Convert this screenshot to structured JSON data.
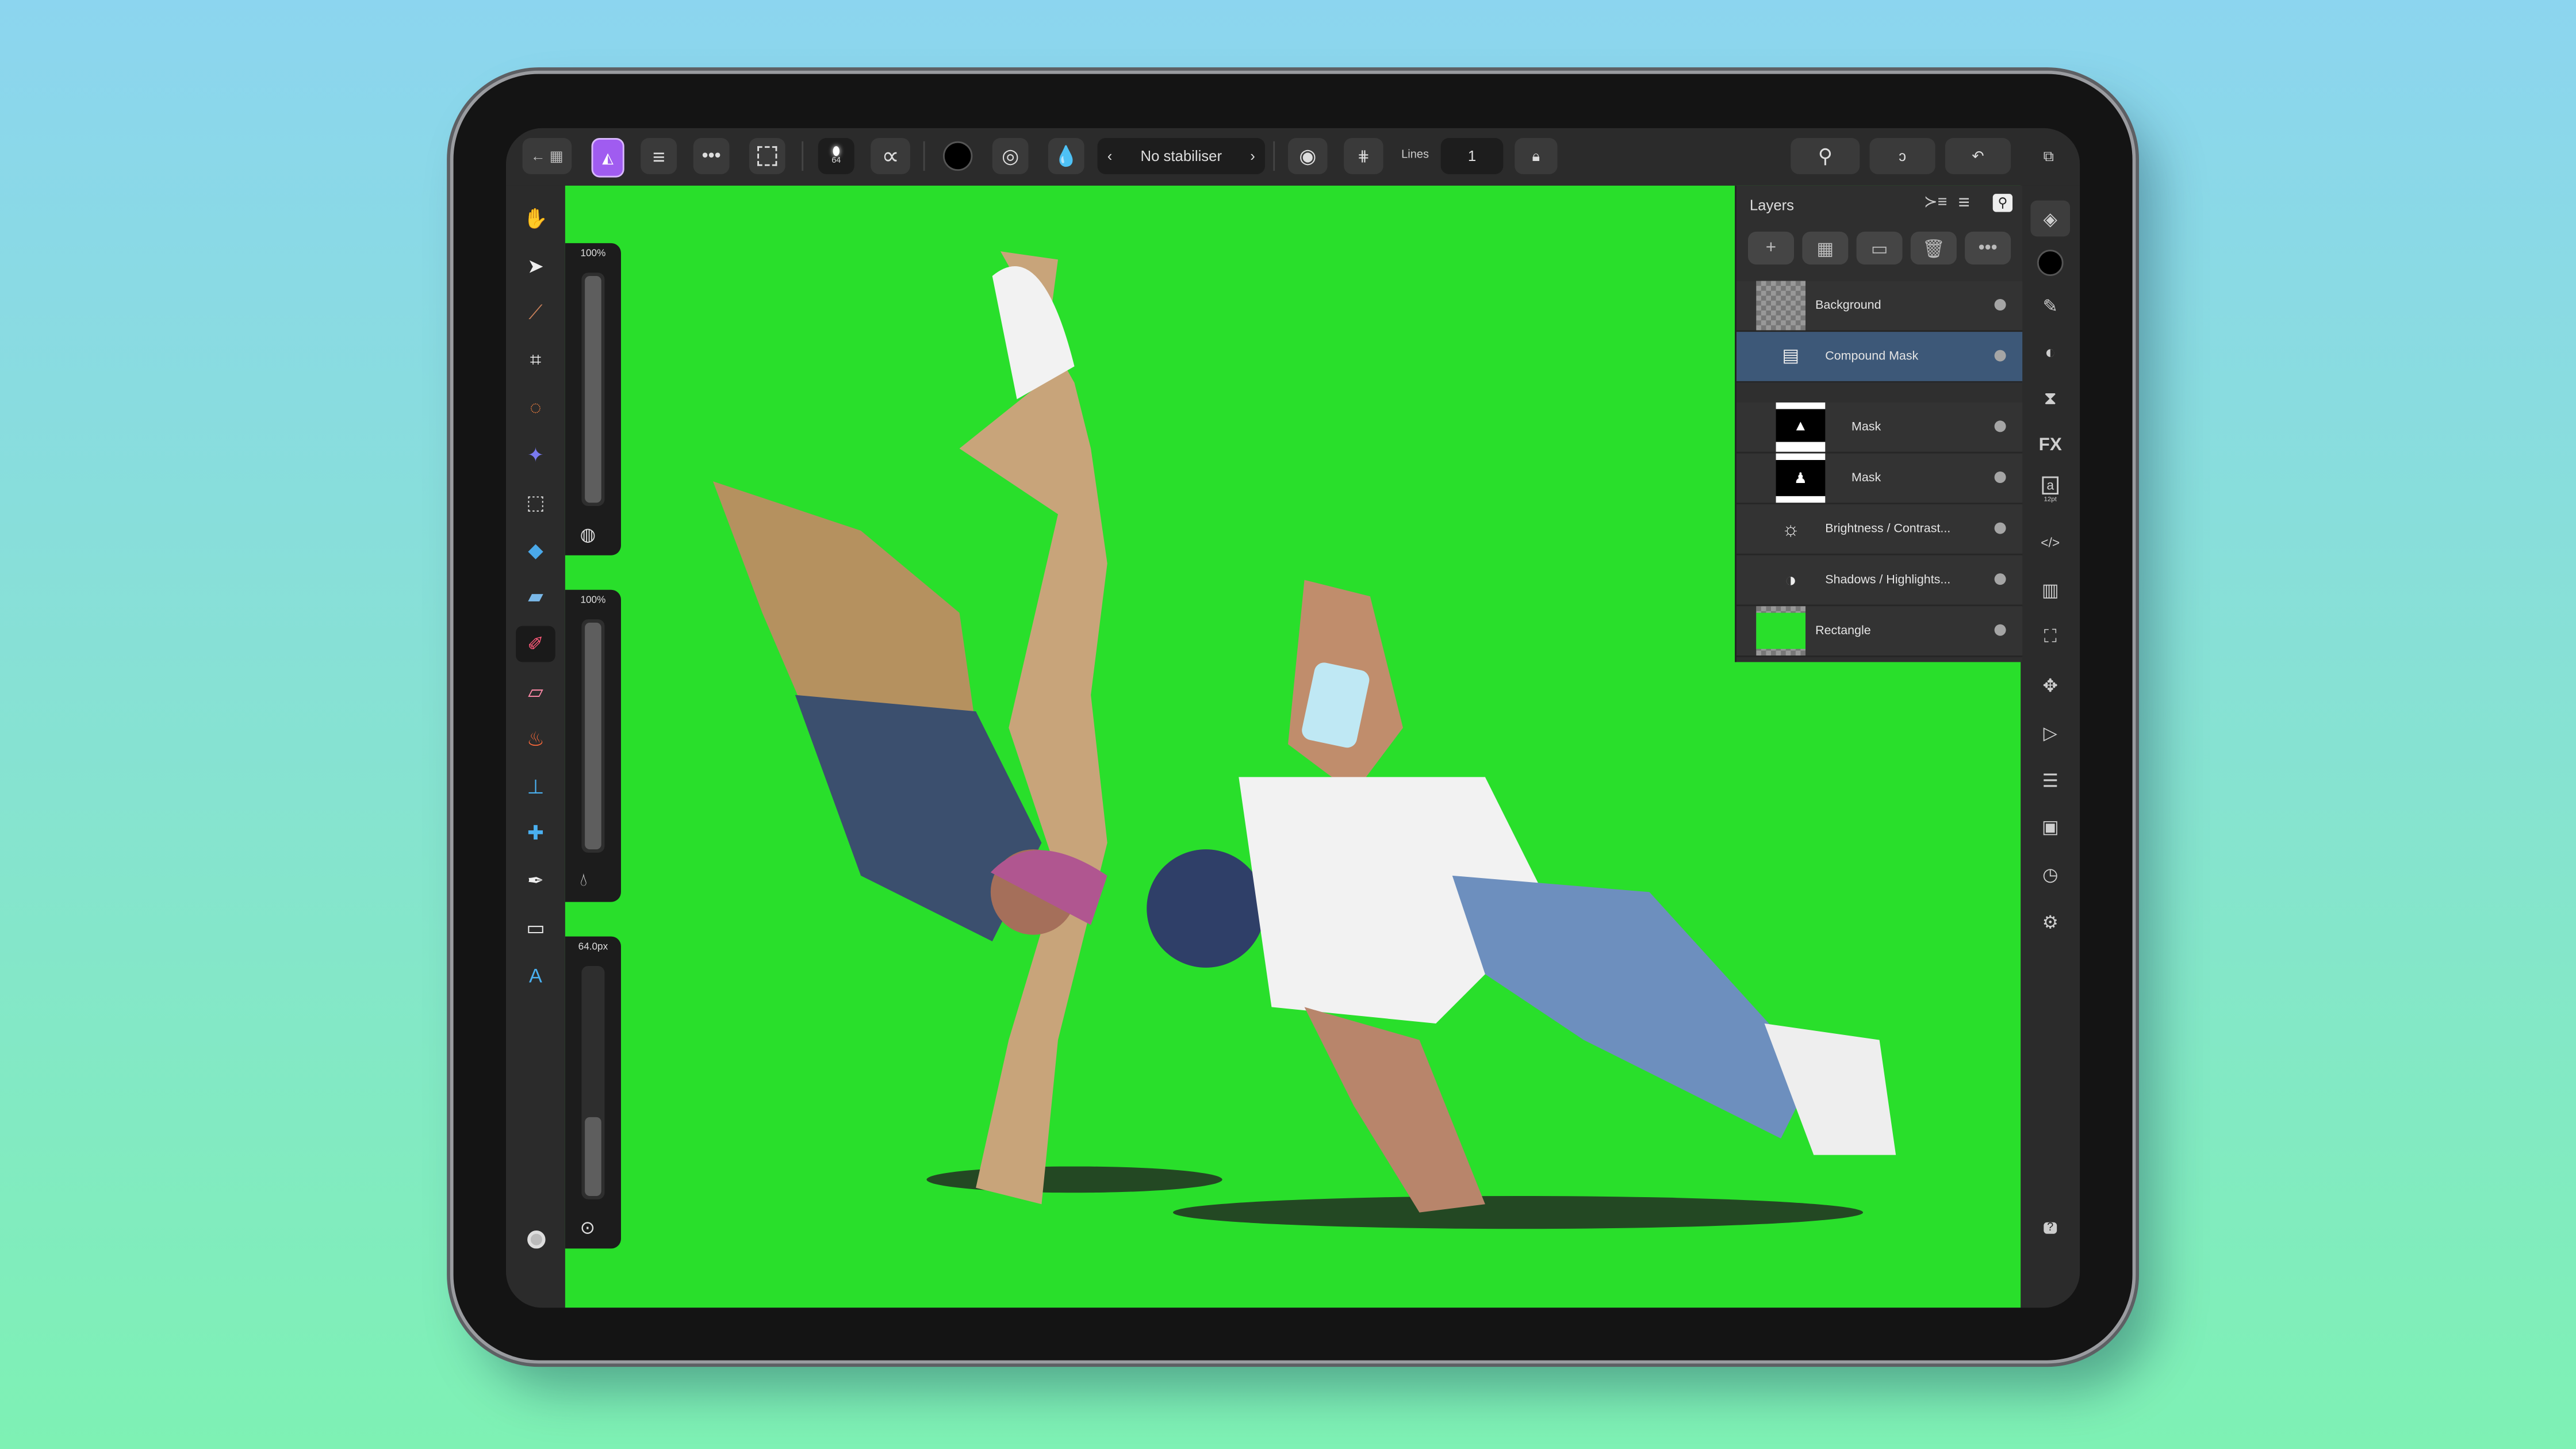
{
  "toolbar": {
    "brush_size": "64",
    "stabiliser": {
      "prev": "‹",
      "label": "No stabiliser",
      "next": "›"
    },
    "lines_label": "Lines",
    "lines_value": "1",
    "current_color": "#000000"
  },
  "left_tools": [
    {
      "name": "view-tool",
      "icon": "hand-icon"
    },
    {
      "name": "move-tool",
      "icon": "pointer-icon"
    },
    {
      "name": "color-picker-tool",
      "icon": "eyedropper-icon"
    },
    {
      "name": "crop-tool",
      "icon": "crop-icon"
    },
    {
      "name": "selection-brush-tool",
      "icon": "selection-brush-icon"
    },
    {
      "name": "flood-select-tool",
      "icon": "magic-wand-icon"
    },
    {
      "name": "marquee-tool",
      "icon": "marquee-icon"
    },
    {
      "name": "flood-fill-tool",
      "icon": "paint-bucket-icon"
    },
    {
      "name": "gradient-tool",
      "icon": "gradient-icon"
    },
    {
      "name": "paint-brush-tool",
      "icon": "brush-icon",
      "active": true
    },
    {
      "name": "erase-brush-tool",
      "icon": "eraser-icon"
    },
    {
      "name": "dodge-brush-tool",
      "icon": "flame-icon"
    },
    {
      "name": "clone-brush-tool",
      "icon": "stamp-icon"
    },
    {
      "name": "healing-brush-tool",
      "icon": "healing-icon"
    },
    {
      "name": "pen-tool",
      "icon": "pen-icon"
    },
    {
      "name": "rectangle-tool",
      "icon": "rectangle-icon"
    },
    {
      "name": "text-tool",
      "icon": "text-icon"
    }
  ],
  "sliders": [
    {
      "label": "100%",
      "value_percent": 100,
      "icon": "opacity-icon"
    },
    {
      "label": "100%",
      "value_percent": 100,
      "icon": "flow-icon"
    },
    {
      "label": "64.0px",
      "value_percent": 35,
      "icon": "size-icon"
    }
  ],
  "layers_panel": {
    "title": "Layers",
    "layers": [
      {
        "name": "Background",
        "thumb": "photo",
        "indent": 0,
        "selected": false
      },
      {
        "name": "Compound Mask",
        "thumb": "compound-mask",
        "indent": 1,
        "selected": true
      },
      {
        "name": "Mask",
        "thumb": "mask-1",
        "indent": 2,
        "selected": false
      },
      {
        "name": "Mask",
        "thumb": "mask-2",
        "indent": 2,
        "selected": false
      },
      {
        "name": "Brightness / Contrast...",
        "thumb": "brightness-contrast",
        "indent": 1,
        "selected": false
      },
      {
        "name": "Shadows / Highlights...",
        "thumb": "shadows-highlights",
        "indent": 1,
        "selected": false
      },
      {
        "name": "Rectangle",
        "thumb": "green-rect",
        "indent": 0,
        "selected": false
      }
    ]
  },
  "right_studio": {
    "text_size": "12pt",
    "help": "?"
  },
  "colors": {
    "canvas": "#29df2b",
    "selection": "#3d5878",
    "accent": "#a05cf0"
  }
}
